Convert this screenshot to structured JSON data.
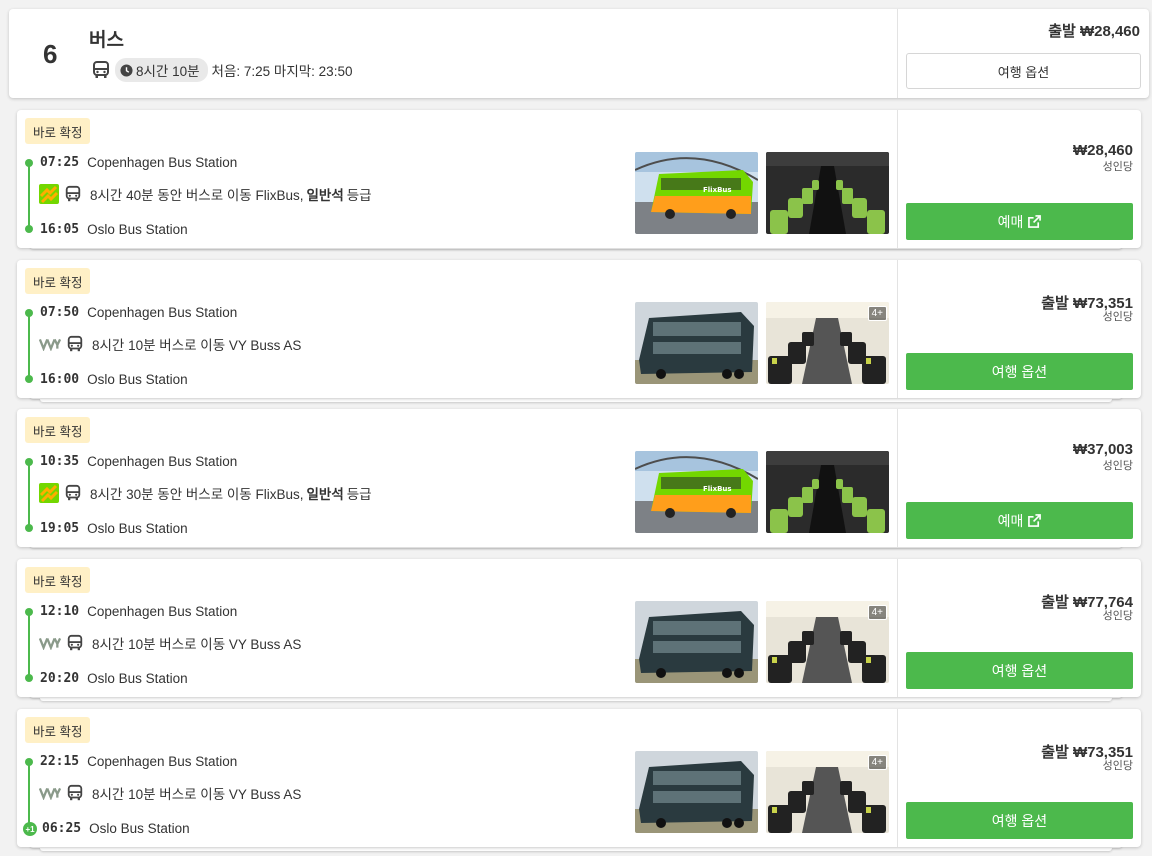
{
  "header": {
    "count": "6",
    "title": "버스",
    "duration": "8시간 10분",
    "first_last": "처음: 7:25 마지막: 23:50",
    "from_price": "출발 ₩28,460",
    "options_button": "여행 옵션"
  },
  "rows": [
    {
      "badge": "바로 확정",
      "dep_time": "07:25",
      "dep_station": "Copenhagen Bus Station",
      "summary_prefix": "8시간 40분 동안 버스로 이동 FlixBus,",
      "summary_bold": "일반석",
      "summary_suffix": "등급",
      "arr_time": "16:05",
      "arr_station": "Oslo Bus Station",
      "price": "₩28,460",
      "per": "성인당",
      "cta": "예매",
      "operator_icon": "flixbus-logo-icon"
    },
    {
      "badge": "바로 확정",
      "dep_time": "07:50",
      "dep_station": "Copenhagen Bus Station",
      "summary_prefix": "8시간 10분 버스로 이동 VY Buss AS",
      "arr_time": "16:00",
      "arr_station": "Oslo Bus Station",
      "price": "출발 ₩73,351",
      "per": "성인당",
      "cta": "여행 옵션",
      "more_photos": "4+",
      "operator_icon": "vy-logo-icon"
    },
    {
      "badge": "바로 확정",
      "dep_time": "10:35",
      "dep_station": "Copenhagen Bus Station",
      "summary_prefix": "8시간 30분 동안 버스로 이동 FlixBus,",
      "summary_bold": "일반석",
      "summary_suffix": "등급",
      "arr_time": "19:05",
      "arr_station": "Oslo Bus Station",
      "price": "₩37,003",
      "per": "성인당",
      "cta": "예매",
      "operator_icon": "flixbus-logo-icon"
    },
    {
      "badge": "바로 확정",
      "dep_time": "12:10",
      "dep_station": "Copenhagen Bus Station",
      "summary_prefix": "8시간 10분 버스로 이동 VY Buss AS",
      "arr_time": "20:20",
      "arr_station": "Oslo Bus Station",
      "price": "출발 ₩77,764",
      "per": "성인당",
      "cta": "여행 옵션",
      "more_photos": "4+",
      "operator_icon": "vy-logo-icon"
    },
    {
      "badge": "바로 확정",
      "dep_time": "22:15",
      "dep_station": "Copenhagen Bus Station",
      "summary_prefix": "8시간 10분 버스로 이동 VY Buss AS",
      "arr_time": "06:25",
      "arr_station": "Oslo Bus Station",
      "next_day": "+1",
      "price": "출발 ₩73,351",
      "per": "성인당",
      "cta": "여행 옵션",
      "more_photos": "4+",
      "operator_icon": "vy-logo-icon"
    }
  ],
  "colors": {
    "accent_green": "#4cb94c",
    "badge_bg": "#fff0c6",
    "flixbus_green": "#73d700",
    "flixbus_orange": "#ffad00"
  }
}
